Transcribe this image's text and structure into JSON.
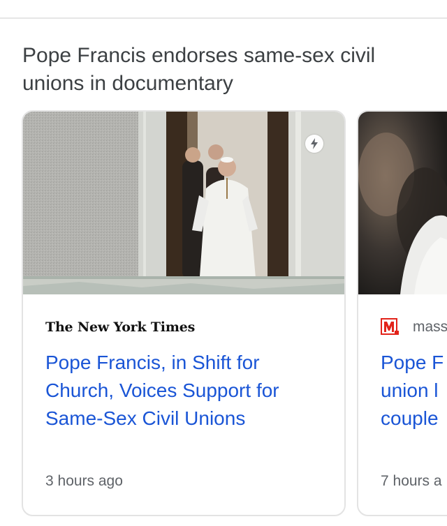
{
  "headline": "Pope Francis endorses same-sex civil unions in documentary",
  "cards": [
    {
      "source": "The New York Times",
      "title": "Pope Francis, in Shift for Church, Voices Support for Same-Sex Civil Unions",
      "time": "3 hours ago",
      "amp_icon": "lightning-bolt-icon"
    },
    {
      "source": "mass",
      "title": "Pope F union l couple",
      "title_lines": [
        "Pope F",
        "union l",
        "couple"
      ],
      "time": "7 hours a",
      "logo_icon": "masslive-m-icon"
    }
  ],
  "colors": {
    "link": "#1a55d6",
    "meta": "#5f6368",
    "headline": "#3c4043",
    "masslive_red": "#e2231a"
  }
}
